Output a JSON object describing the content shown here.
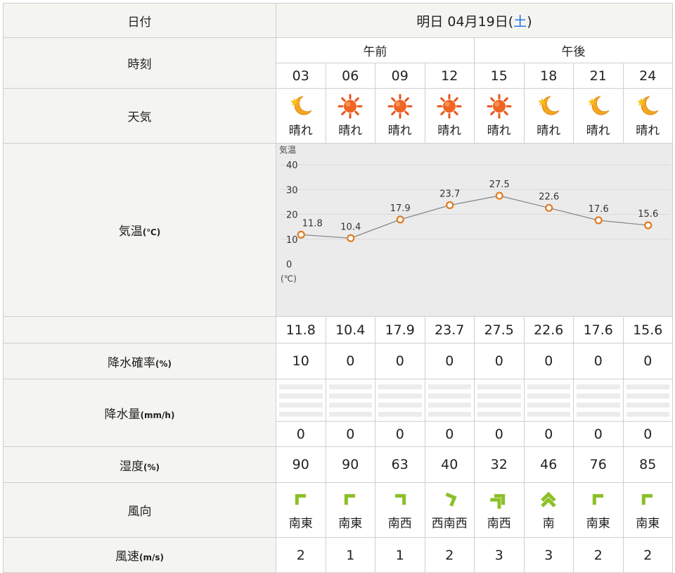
{
  "header": {
    "date_label": "日付",
    "date_prefix": "明日 04月19日(",
    "date_weekday": "土",
    "date_suffix": ")"
  },
  "rows": {
    "time": "時刻",
    "weather": "天気",
    "temp": "気温",
    "temp_unit": "(℃)",
    "precip_prob": "降水確率",
    "precip_prob_unit": "(%)",
    "precip_amount": "降水量",
    "precip_amount_unit": "(mm/h)",
    "humidity": "湿度",
    "humidity_unit": "(%)",
    "wind_dir": "風向",
    "wind_speed": "風速",
    "wind_speed_unit": "(m/s)"
  },
  "ampm": [
    "午前",
    "午後"
  ],
  "hours": [
    "03",
    "06",
    "09",
    "12",
    "15",
    "18",
    "21",
    "24"
  ],
  "weather": [
    {
      "icon": "moon-icon",
      "label": "晴れ"
    },
    {
      "icon": "sun-icon",
      "label": "晴れ"
    },
    {
      "icon": "sun-icon",
      "label": "晴れ"
    },
    {
      "icon": "sun-icon",
      "label": "晴れ"
    },
    {
      "icon": "sun-icon",
      "label": "晴れ"
    },
    {
      "icon": "moon-icon",
      "label": "晴れ"
    },
    {
      "icon": "moon-icon",
      "label": "晴れ"
    },
    {
      "icon": "moon-icon",
      "label": "晴れ"
    }
  ],
  "temperature": [
    "11.8",
    "10.4",
    "17.9",
    "23.7",
    "27.5",
    "22.6",
    "17.6",
    "15.6"
  ],
  "precip_prob": [
    "10",
    "0",
    "0",
    "0",
    "0",
    "0",
    "0",
    "0"
  ],
  "precip_amount": [
    "0",
    "0",
    "0",
    "0",
    "0",
    "0",
    "0",
    "0"
  ],
  "humidity": [
    "90",
    "90",
    "63",
    "40",
    "32",
    "46",
    "76",
    "85"
  ],
  "wind": [
    {
      "dir": "南東",
      "strength": 1
    },
    {
      "dir": "南東",
      "strength": 1
    },
    {
      "dir": "南西",
      "strength": 1
    },
    {
      "dir": "西南西",
      "strength": 1
    },
    {
      "dir": "南西",
      "strength": 2
    },
    {
      "dir": "南",
      "strength": 2
    },
    {
      "dir": "南東",
      "strength": 1
    },
    {
      "dir": "南東",
      "strength": 1
    }
  ],
  "wind_speed": [
    "2",
    "1",
    "1",
    "2",
    "3",
    "3",
    "2",
    "2"
  ],
  "colors": {
    "line": "#8a8a8a",
    "marker": "#e07a1f",
    "arrow": "#8dbf2a",
    "saturday": "#1a73e8"
  },
  "chart_data": {
    "type": "line",
    "title": "気温",
    "unit": "(℃)",
    "x": [
      "03",
      "06",
      "09",
      "12",
      "15",
      "18",
      "21",
      "24"
    ],
    "series": [
      {
        "values": [
          11.8,
          10.4,
          17.9,
          23.7,
          27.5,
          22.6,
          17.6,
          15.6
        ]
      }
    ],
    "yticks": [
      0,
      10,
      20,
      30,
      40
    ],
    "ylim": [
      0,
      40
    ],
    "grid": true,
    "data_labels": true
  }
}
